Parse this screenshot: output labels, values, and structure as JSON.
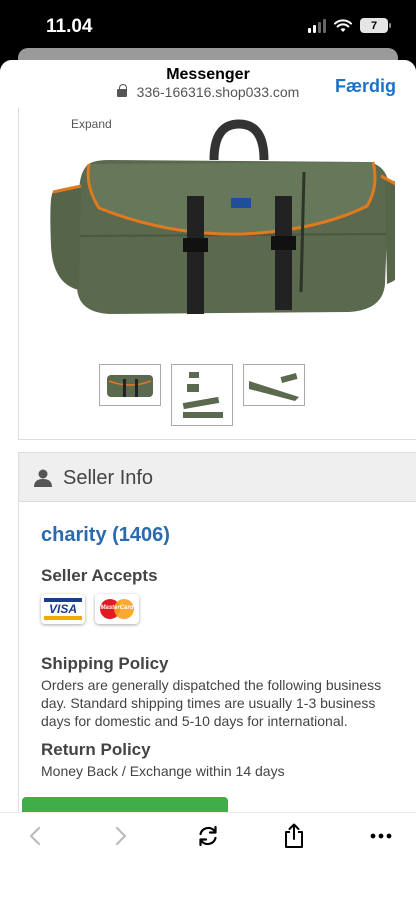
{
  "status": {
    "time": "11.04",
    "battery": "7"
  },
  "topbar": {
    "title": "Messenger",
    "url": "336-166316.shop033.com",
    "done_label": "Færdig"
  },
  "gallery": {
    "expand_label": "Expand",
    "thumbnails": [
      "thumb-bag-front",
      "thumb-bag-parts",
      "thumb-bag-folded"
    ]
  },
  "seller": {
    "header_title": "Seller Info",
    "name": "charity (1406)",
    "accepts_heading": "Seller Accepts",
    "payment_cards": [
      {
        "name": "visa",
        "label": "VISA"
      },
      {
        "name": "mastercard",
        "label": "MasterCard"
      }
    ],
    "shipping_heading": "Shipping Policy",
    "shipping_text": "Orders are generally dispatched the following business day. Standard shipping times are usually 1-3 business days for domestic and 5-10 days for international.",
    "return_heading": "Return Policy",
    "return_text": "Money Back / Exchange within 14 days"
  },
  "colors": {
    "accent": "#1a73c8",
    "link": "#2a6ab0",
    "button_green": "#3fae49",
    "bag_green": "#5b6a4e",
    "bag_trim": "#e07a1f"
  }
}
